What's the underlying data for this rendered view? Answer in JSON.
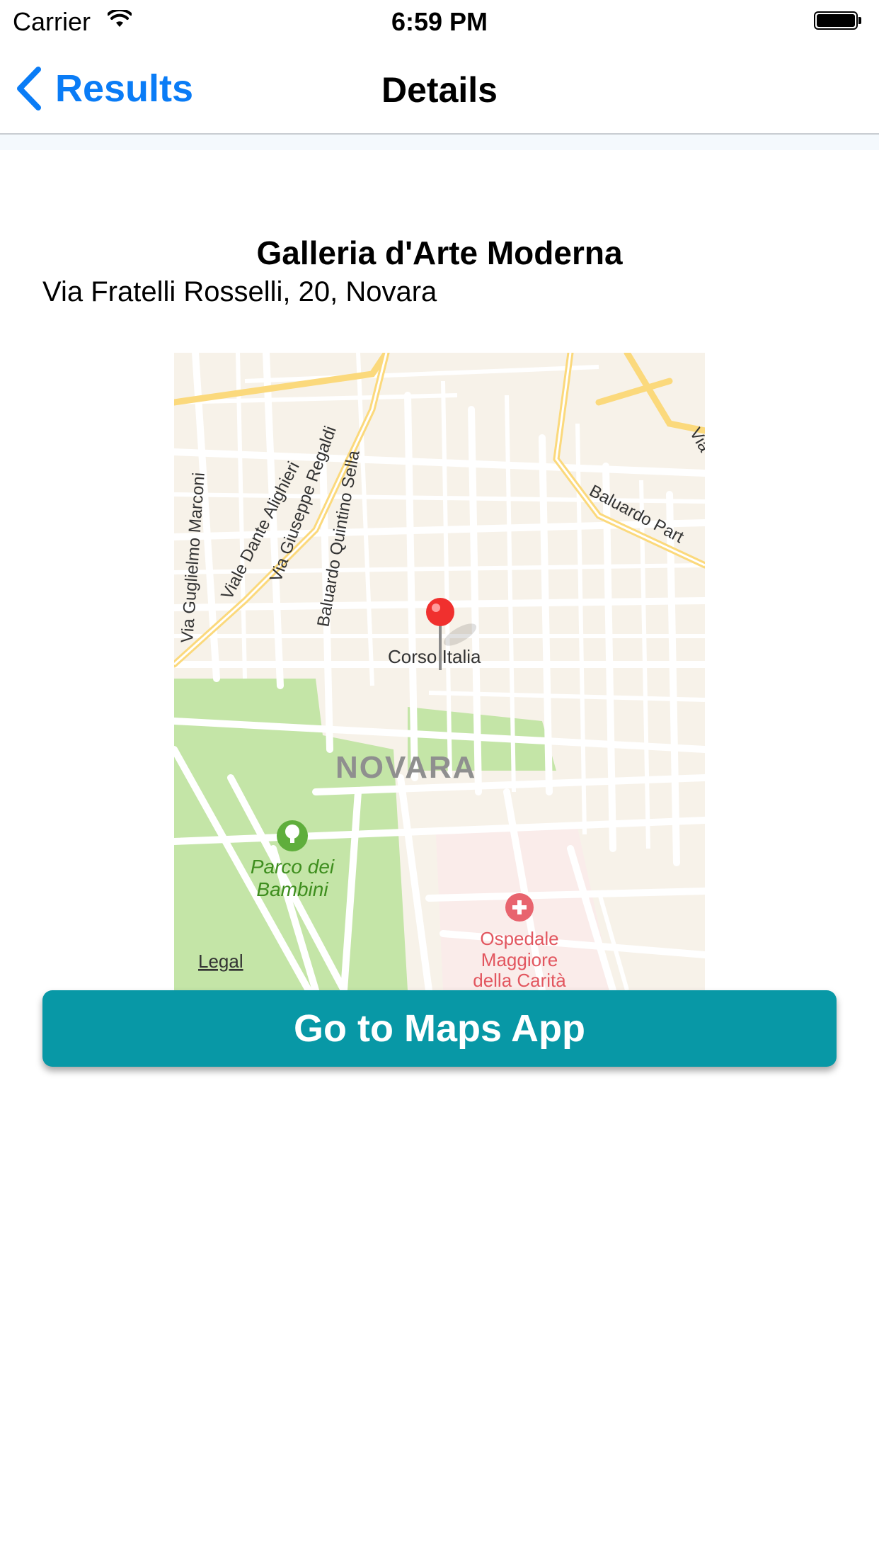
{
  "status_bar": {
    "carrier": "Carrier",
    "time": "6:59 PM"
  },
  "nav": {
    "back_label": "Results",
    "title": "Details"
  },
  "place": {
    "name": "Galleria d'Arte Moderna",
    "address": "Via Fratelli Rosselli, 20, Novara"
  },
  "map": {
    "city_label": "NOVARA",
    "streets": {
      "marconi": "Via Guglielmo Marconi",
      "alighieri": "Viale Dante Alighieri",
      "regaldi": "Via Giuseppe Regaldi",
      "sella": "Baluardo Quintino Sella",
      "corso": "Corso Italia",
      "baluardo_partigiani": "Baluardo Part",
      "via_top_right": "Via"
    },
    "park_label_line1": "Parco dei",
    "park_label_line2": "Bambini",
    "hospital_line1": "Ospedale",
    "hospital_line2": "Maggiore",
    "hospital_line3": "della Carità",
    "legal": "Legal",
    "colors": {
      "park": "#c4e5a7",
      "hospital_area": "#faecea",
      "major_road": "#fbd97c",
      "land": "#f7f2e9",
      "pin": "#f0302e"
    }
  },
  "actions": {
    "open_maps_label": "Go to Maps App",
    "button_color": "#0898a6"
  }
}
